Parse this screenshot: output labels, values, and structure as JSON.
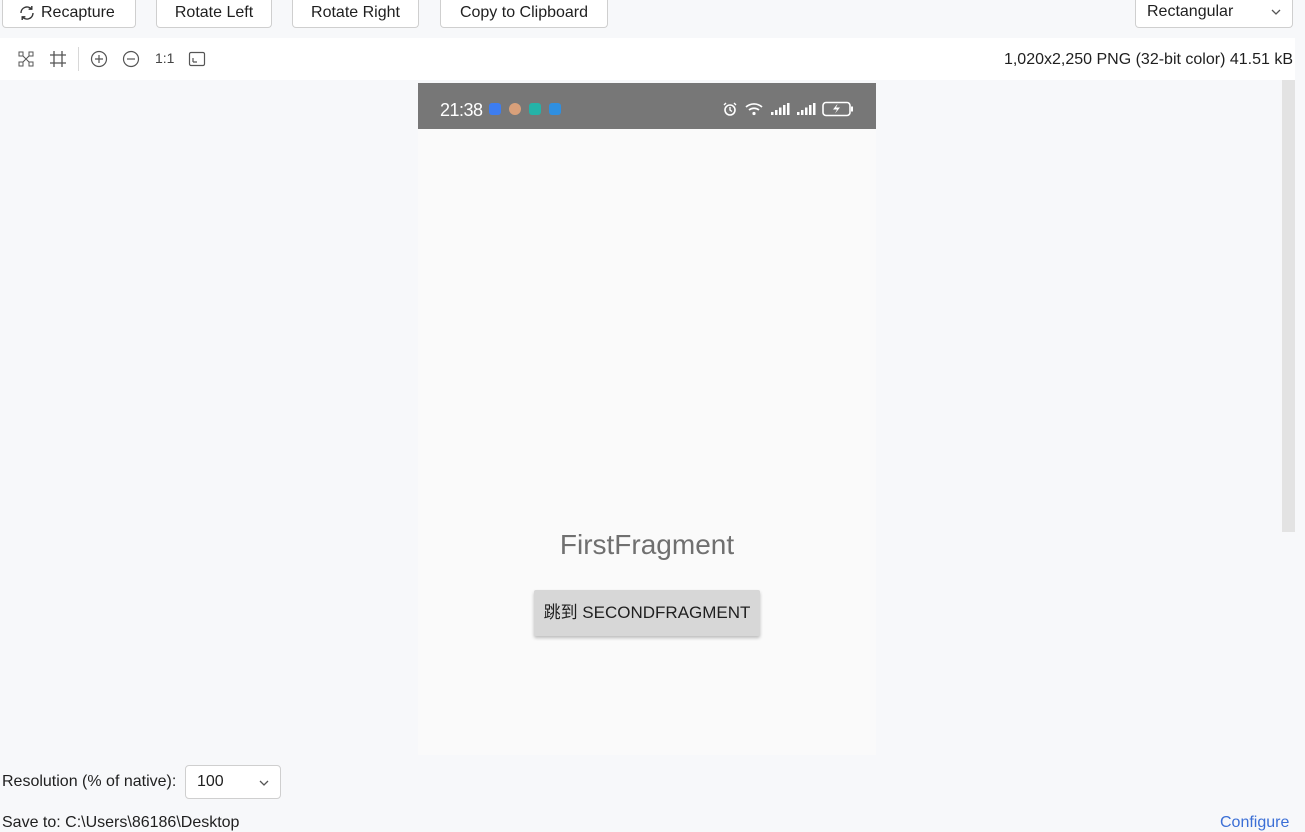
{
  "toolbar": {
    "recapture_label": "Recapture",
    "rotate_left_label": "Rotate Left",
    "rotate_right_label": "Rotate Right",
    "copy_label": "Copy to Clipboard",
    "shape_select_value": "Rectangular"
  },
  "viewer": {
    "one_to_one_label": "1:1",
    "image_info": "1,020x2,250 PNG (32-bit color) 41.51 kB",
    "tools": [
      "fit-icon",
      "crop-icon",
      "zoom-in-icon",
      "zoom-out-icon",
      "actual-size-icon",
      "fit-window-icon"
    ]
  },
  "device": {
    "time": "21:38",
    "status_icons": [
      "alarm-icon",
      "wifi-icon",
      "signal-icon",
      "signal-icon",
      "battery-charging-icon"
    ],
    "fragment_title": "FirstFragment",
    "fragment_button_label": "跳到 SECONDFRAGMENT",
    "statusbar_color": "#777777"
  },
  "footer": {
    "resolution_label": "Resolution (% of native):",
    "resolution_value": "100",
    "save_path": "Save to:  C:\\Users\\86186\\Desktop",
    "configure_label": "Configure"
  },
  "colors": {
    "accent": "#3b6fd6",
    "background": "#f7f8fa"
  }
}
